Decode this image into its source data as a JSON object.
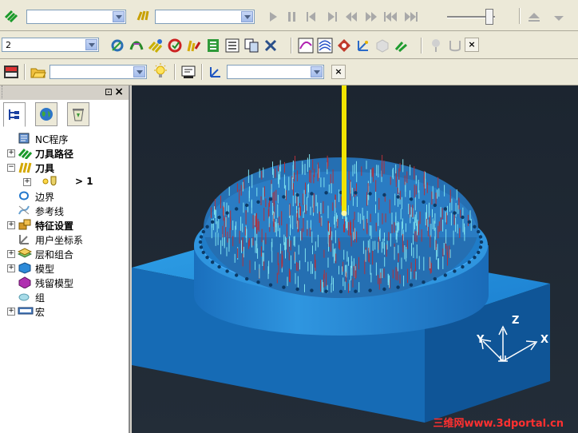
{
  "toolbar1": {
    "combo1": "",
    "combo2": ""
  },
  "toolbar2": {
    "combo": "2"
  },
  "toolbar3": {
    "combo1": "",
    "combo2": "",
    "close": "×"
  },
  "toolbar2_close": "×",
  "panel": {
    "pin": "⊡",
    "close": "×",
    "tree": [
      {
        "label": "NC程序",
        "bold": false,
        "expander": ""
      },
      {
        "label": "刀具路径",
        "bold": true,
        "expander": "+"
      },
      {
        "label": "刀具",
        "bold": true,
        "expander": "−"
      },
      {
        "label": "> 1",
        "bold": true,
        "expander": "+"
      },
      {
        "label": "边界",
        "bold": false,
        "expander": ""
      },
      {
        "label": "参考线",
        "bold": false,
        "expander": ""
      },
      {
        "label": "特征设置",
        "bold": true,
        "expander": "+"
      },
      {
        "label": "用户坐标系",
        "bold": false,
        "expander": ""
      },
      {
        "label": "层和组合",
        "bold": false,
        "expander": "+"
      },
      {
        "label": "模型",
        "bold": false,
        "expander": "+"
      },
      {
        "label": "残留模型",
        "bold": false,
        "expander": ""
      },
      {
        "label": "组",
        "bold": false,
        "expander": ""
      },
      {
        "label": "宏",
        "bold": false,
        "expander": "+"
      }
    ]
  },
  "viewport": {
    "axis_x": "X",
    "axis_y": "Y",
    "axis_z": "Z",
    "watermark": "三维网www.3dportal.cn"
  }
}
